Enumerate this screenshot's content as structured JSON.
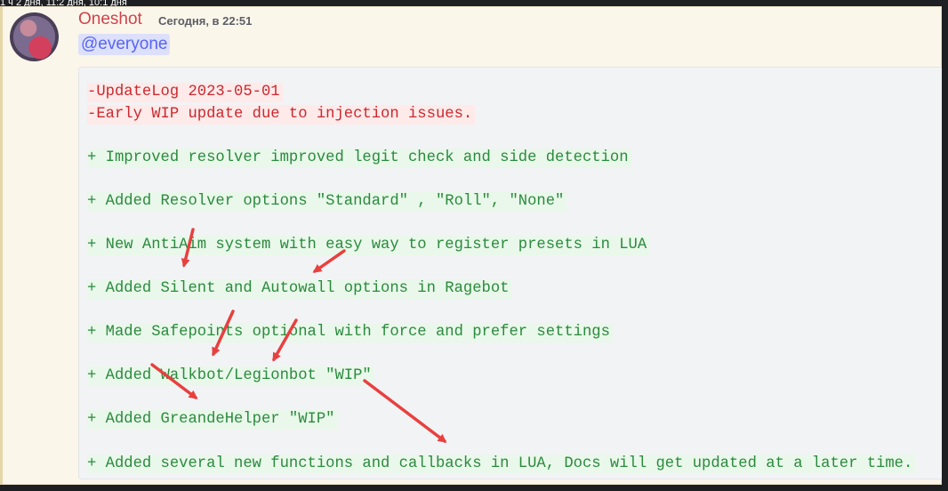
{
  "top_strip_text": "1 ч 2 дня, 11:2 дня, 10:1 дня",
  "message": {
    "author": "Oneshot",
    "timestamp": "Сегодня, в 22:51",
    "mention": "@everyone",
    "code_lines": [
      "-UpdateLog 2023-05-01",
      "-Early WIP update due to injection issues.",
      "+ Improved resolver improved legit check and side detection",
      "+ Added Resolver options \"Standard\" , \"Roll\", \"None\"",
      "+ New AntiAim system with easy way to register presets in LUA",
      "+ Added Silent and Autowall options in Ragebot",
      "+ Made Safepoints optional with force and prefer settings",
      "+ Added Walkbot/Legionbot \"WIP\"",
      "+ Added GreandeHelper \"WIP\"",
      "+ Added several new functions and callbacks in LUA, Docs will get updated at a later time."
    ]
  },
  "colors": {
    "removed_line": "#c9292e",
    "added_line": "#2b8a3e",
    "annotation_arrow": "#e8403f",
    "author_name": "#d0434b",
    "mention": "#5865f2"
  }
}
